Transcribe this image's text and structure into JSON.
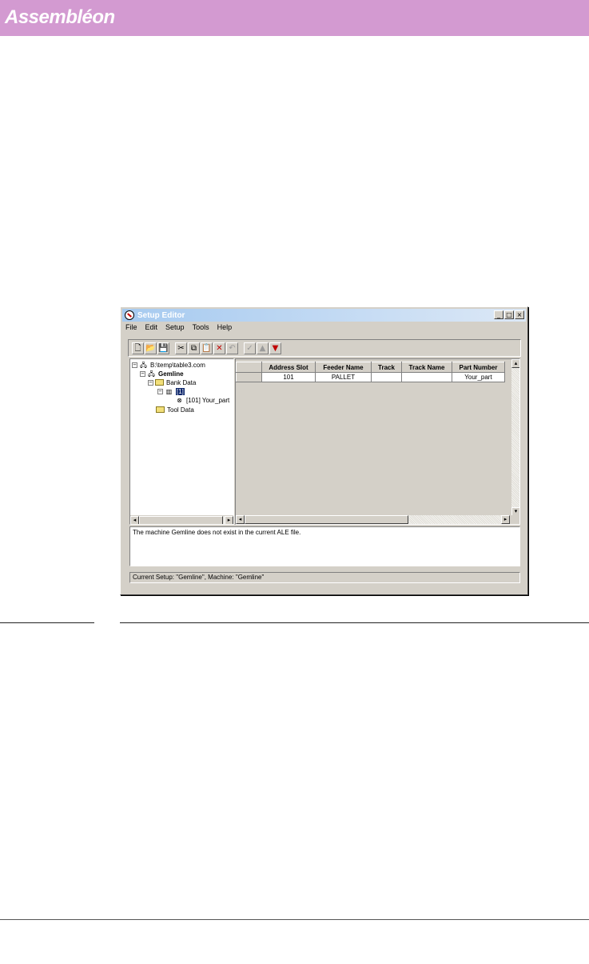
{
  "brand": {
    "logo": "Assembléon",
    "color": "#d39ad1"
  },
  "window": {
    "title": "Setup Editor",
    "controls": {
      "minimize": "_",
      "maximize": "□",
      "close": "×"
    },
    "menu": [
      "File",
      "Edit",
      "Setup",
      "Tools",
      "Help"
    ],
    "toolbar": [
      {
        "name": "new-icon",
        "glyph": "🗋"
      },
      {
        "name": "open-icon",
        "glyph": "📂"
      },
      {
        "name": "save-icon",
        "glyph": "💾"
      },
      {
        "name": "cut-icon",
        "glyph": "✂"
      },
      {
        "name": "copy-icon",
        "glyph": "⧉"
      },
      {
        "name": "paste-icon",
        "glyph": "📋"
      },
      {
        "name": "delete-icon",
        "glyph": "✕"
      },
      {
        "name": "undo-icon",
        "glyph": "↶"
      },
      {
        "name": "check-icon",
        "glyph": "✓"
      },
      {
        "name": "up-arrow-icon",
        "glyph": "▲"
      },
      {
        "name": "down-arrow-icon",
        "glyph": "▼"
      }
    ],
    "tree": {
      "root": "B:\\temp\\table3.com",
      "machine": "Gemline",
      "bank_data": "Bank Data",
      "feeder": "[1]",
      "part": "[101] Your_part",
      "tool_data": "Tool Data"
    },
    "grid": {
      "columns": [
        "Address Slot",
        "Feeder Name",
        "Track",
        "Track Name",
        "Part Number"
      ],
      "rows": [
        [
          "101",
          "PALLET",
          "",
          "",
          "Your_part"
        ]
      ]
    },
    "message": "The machine Gemline does not exist in the current ALE file.",
    "status": "Current Setup: \"Gemline\", Machine: \"Gemline\""
  }
}
